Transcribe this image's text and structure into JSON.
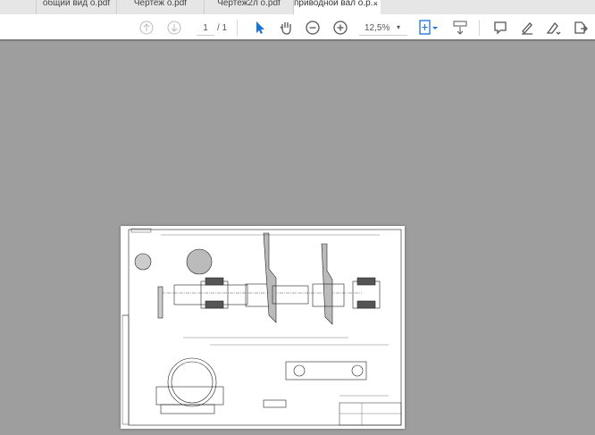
{
  "tabs": [
    {
      "label": "общий вид о.pdf"
    },
    {
      "label": "Чертеж о.pdf"
    },
    {
      "label": "Чертеж2л о.pdf"
    },
    {
      "label": "приводной вал о.р...",
      "active": true,
      "close": "×"
    }
  ],
  "toolbar": {
    "page_current": "1",
    "page_total": "/ 1",
    "zoom": "12,5%",
    "dropdown": "▾"
  },
  "colors": {
    "accent": "#1a73d9",
    "canvas": "#9e9e9e"
  }
}
